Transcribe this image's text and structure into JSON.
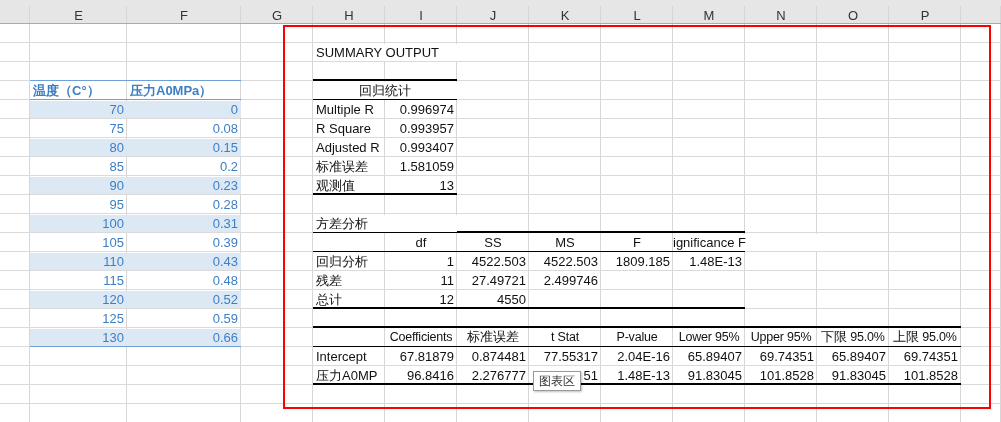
{
  "column_headers": [
    "E",
    "F",
    "G",
    "H",
    "I",
    "J",
    "K",
    "L",
    "M",
    "N",
    "O",
    "P"
  ],
  "data_table": {
    "columns": [
      "温度（C°）",
      "压力A0MPa）"
    ],
    "rows": [
      [
        "70",
        "0"
      ],
      [
        "75",
        "0.08"
      ],
      [
        "80",
        "0.15"
      ],
      [
        "85",
        "0.2"
      ],
      [
        "90",
        "0.23"
      ],
      [
        "95",
        "0.28"
      ],
      [
        "100",
        "0.31"
      ],
      [
        "105",
        "0.39"
      ],
      [
        "110",
        "0.43"
      ],
      [
        "115",
        "0.48"
      ],
      [
        "120",
        "0.52"
      ],
      [
        "125",
        "0.59"
      ],
      [
        "130",
        "0.66"
      ]
    ]
  },
  "summary": {
    "title": "SUMMARY OUTPUT",
    "regression_statistics": {
      "heading": "回归统计",
      "rows": [
        [
          "Multiple R",
          "0.996974"
        ],
        [
          "R Square",
          "0.993957"
        ],
        [
          "Adjusted R",
          "0.993407"
        ],
        [
          "标准误差",
          "1.581059"
        ],
        [
          "观测值",
          "13"
        ]
      ]
    },
    "anova": {
      "heading": "方差分析",
      "columns": [
        "",
        "df",
        "SS",
        "MS",
        "F",
        "ignificance F"
      ],
      "rows": [
        [
          "回归分析",
          "1",
          "4522.503",
          "4522.503",
          "1809.185",
          "1.48E-13"
        ],
        [
          "残差",
          "11",
          "27.49721",
          "2.499746"
        ],
        [
          "总计",
          "12",
          "4550"
        ]
      ]
    },
    "coefficients": {
      "columns": [
        "",
        "Coefficients",
        "标准误差",
        "t Stat",
        "P-value",
        "Lower 95%",
        "Upper 95%",
        "下限 95.0%",
        "上限 95.0%"
      ],
      "rows": [
        [
          "Intercept",
          "67.81879",
          "0.874481",
          "77.55317",
          "2.04E-16",
          "65.89407",
          "69.74351",
          "65.89407",
          "69.74351"
        ],
        [
          "压力A0MP",
          "96.8416",
          "2.276777",
          "51",
          "1.48E-13",
          "91.83045",
          "101.8528",
          "91.83045",
          "101.8528"
        ]
      ]
    }
  },
  "tooltip": "图表区"
}
